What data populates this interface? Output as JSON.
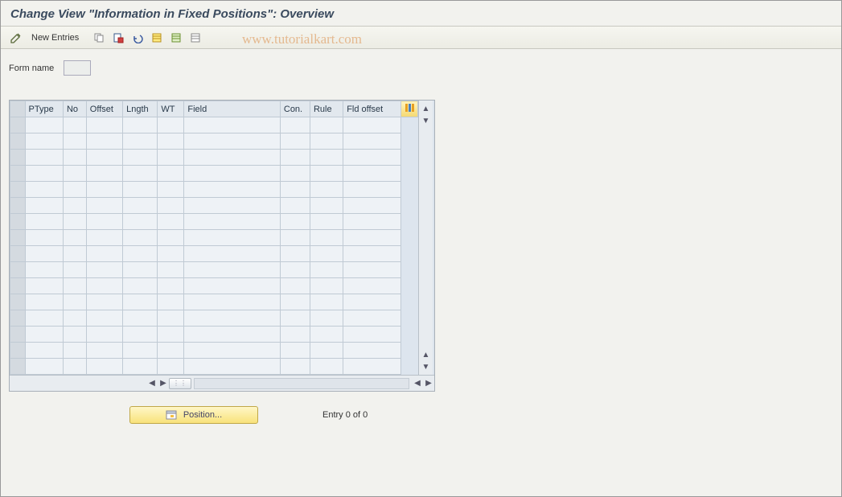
{
  "title": "Change View \"Information in Fixed Positions\": Overview",
  "toolbar": {
    "new_entries_label": "New Entries"
  },
  "watermark": "www.tutorialkart.com",
  "form": {
    "name_label": "Form name",
    "name_value": ""
  },
  "table": {
    "columns": [
      "PType",
      "No",
      "Offset",
      "Lngth",
      "WT",
      "Field",
      "Con.",
      "Rule",
      "Fld offset"
    ],
    "rows": 16
  },
  "footer": {
    "position_label": "Position...",
    "entry_text": "Entry 0 of 0"
  }
}
